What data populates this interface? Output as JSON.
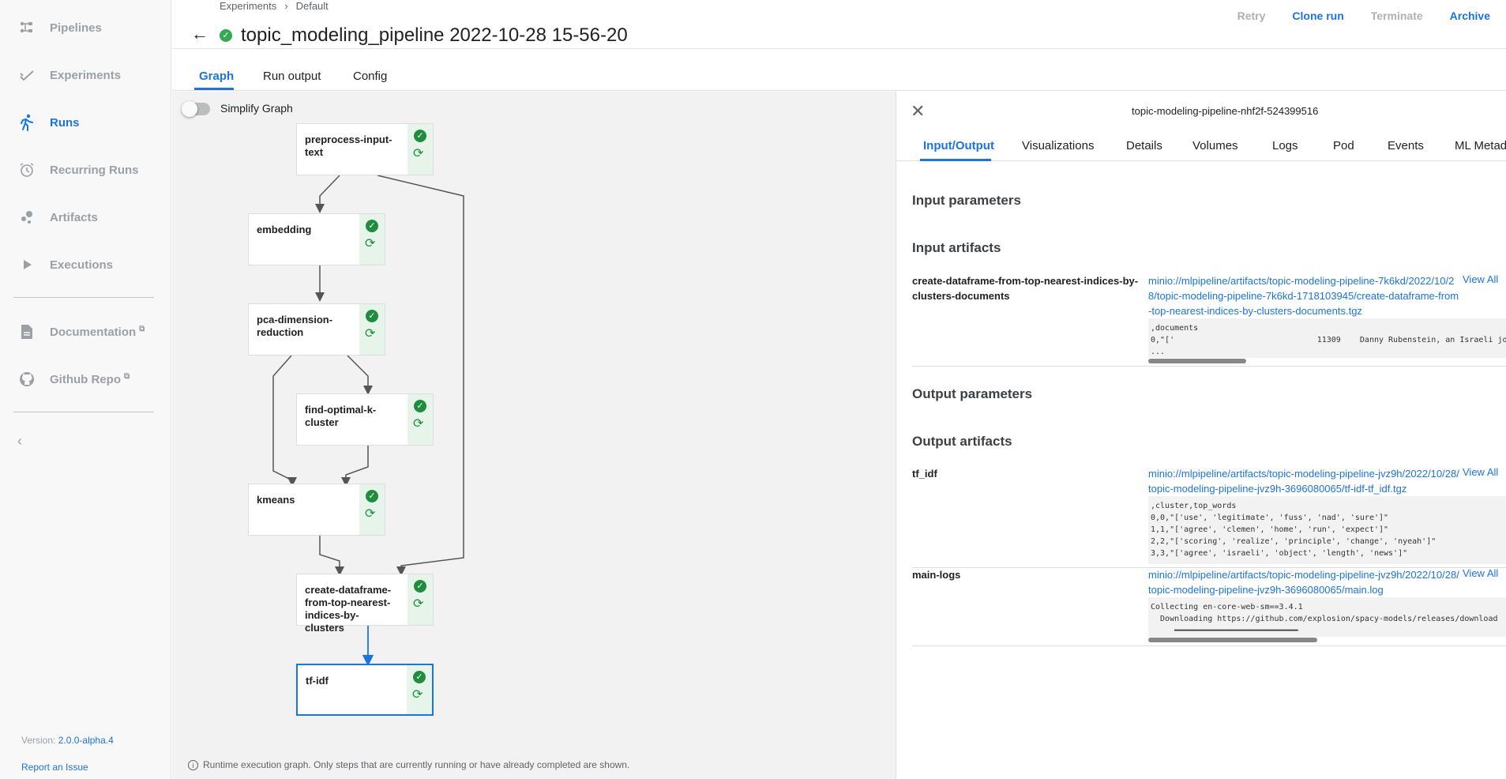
{
  "sidebar": {
    "items": [
      {
        "label": "Pipelines",
        "icon": "pipelines-icon"
      },
      {
        "label": "Experiments",
        "icon": "experiments-icon"
      },
      {
        "label": "Runs",
        "icon": "runs-icon",
        "active": true
      },
      {
        "label": "Recurring Runs",
        "icon": "alarm-icon"
      },
      {
        "label": "Artifacts",
        "icon": "artifacts-icon"
      },
      {
        "label": "Executions",
        "icon": "play-icon"
      },
      {
        "label": "Documentation",
        "icon": "document-icon"
      },
      {
        "label": "Github Repo",
        "icon": "github-icon"
      }
    ],
    "version_label": "Version:",
    "version": "2.0.0-alpha.4",
    "report": "Report an Issue"
  },
  "header": {
    "breadcrumbs": [
      "Experiments",
      "Default"
    ],
    "title": "topic_modeling_pipeline 2022-10-28 15-56-20",
    "actions": {
      "retry": "Retry",
      "clone": "Clone run",
      "terminate": "Terminate",
      "archive": "Archive"
    }
  },
  "tabs": [
    "Graph",
    "Run output",
    "Config"
  ],
  "graph": {
    "simplify_label": "Simplify Graph",
    "nodes": [
      "preprocess-input-text",
      "embedding",
      "pca-dimension-reduction",
      "find-optimal-k-cluster",
      "kmeans",
      "create-dataframe-from-top-nearest-indices-by-clusters",
      "tf-idf"
    ],
    "footnote": "Runtime execution graph. Only steps that are currently running or have already completed are shown."
  },
  "panel": {
    "pod_name": "topic-modeling-pipeline-nhf2f-524399516",
    "tabs": [
      "Input/Output",
      "Visualizations",
      "Details",
      "Volumes",
      "Logs",
      "Pod",
      "Events",
      "ML Metad"
    ],
    "input_parameters": "Input parameters",
    "input_artifacts": "Input artifacts",
    "output_parameters": "Output parameters",
    "output_artifacts": "Output artifacts",
    "view_all": "View All",
    "artifacts": {
      "in_docs": {
        "name": "create-dataframe-from-top-nearest-indices-by-clusters-documents",
        "link": "minio://mlpipeline/artifacts/topic-modeling-pipeline-7k6kd/2022/10/28/topic-modeling-pipeline-7k6kd-1718103945/create-dataframe-from-top-nearest-indices-by-clusters-documents.tgz",
        "preview": ",documents\n0,\"['                              11309    Danny Rubenstein, an Israeli journalist\n..."
      },
      "tf_idf": {
        "name": "tf_idf",
        "link": "minio://mlpipeline/artifacts/topic-modeling-pipeline-jvz9h/2022/10/28/topic-modeling-pipeline-jvz9h-3696080065/tf-idf-tf_idf.tgz",
        "preview": ",cluster,top_words\n0,0,\"['use', 'legitimate', 'fuss', 'nad', 'sure']\"\n1,1,\"['agree', 'clemen', 'home', 'run', 'expect']\"\n2,2,\"['scoring', 'realize', 'principle', 'change', 'nyeah']\"\n3,3,\"['agree', 'israeli', 'object', 'length', 'news']\""
      },
      "main_logs": {
        "name": "main-logs",
        "link": "minio://mlpipeline/artifacts/topic-modeling-pipeline-jvz9h/2022/10/28/topic-modeling-pipeline-jvz9h-3696080065/main.log",
        "preview": "Collecting en-core-web-sm==3.4.1\n  Downloading https://github.com/explosion/spacy-models/releases/download\n     ━━━━━━━━━━━━━━━━━━━━━━━━━━"
      }
    }
  }
}
